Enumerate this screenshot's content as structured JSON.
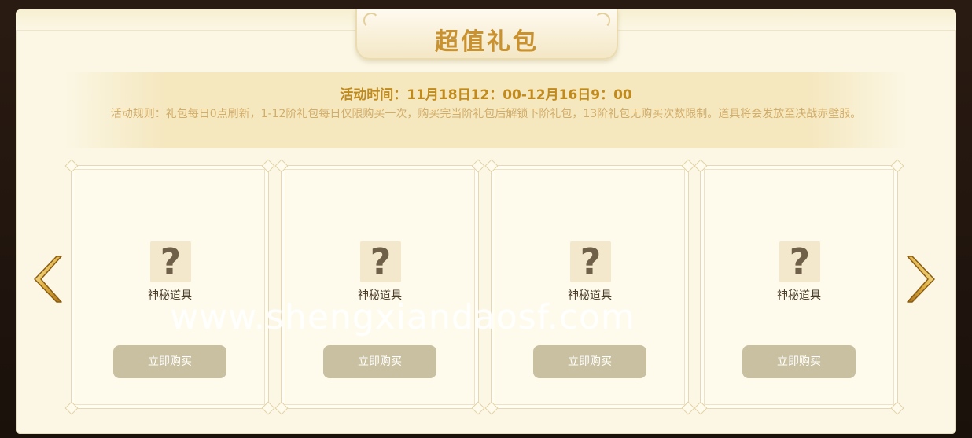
{
  "title": "超值礼包",
  "event": {
    "time": "活动时间：11月18日12：00-12月16日9：00",
    "rules": "活动规则：礼包每日0点刷新，1-12阶礼包每日仅限购买一次，购买完当阶礼包后解锁下阶礼包，13阶礼包无购买次数限制。道具将会发放至决战赤壁服。"
  },
  "items": [
    {
      "icon": "question-mark-icon",
      "icon_glyph": "?",
      "name": "神秘道具",
      "button_label": "立即购买"
    },
    {
      "icon": "question-mark-icon",
      "icon_glyph": "?",
      "name": "神秘道具",
      "button_label": "立即购买"
    },
    {
      "icon": "question-mark-icon",
      "icon_glyph": "?",
      "name": "神秘道具",
      "button_label": "立即购买"
    },
    {
      "icon": "question-mark-icon",
      "icon_glyph": "?",
      "name": "神秘道具",
      "button_label": "立即购买"
    }
  ],
  "navigation": {
    "prev_icon": "chevron-left-icon",
    "next_icon": "chevron-right-icon"
  },
  "watermark": "www.shengxiandaosf.com",
  "colors": {
    "title": "#c9922e",
    "event_time": "#c08a1c",
    "rules_text": "#d2ad6a",
    "button_bg": "#c9c0a2",
    "panel_bg": "#fbf7e4",
    "arrow_gold": "#d9a838"
  }
}
